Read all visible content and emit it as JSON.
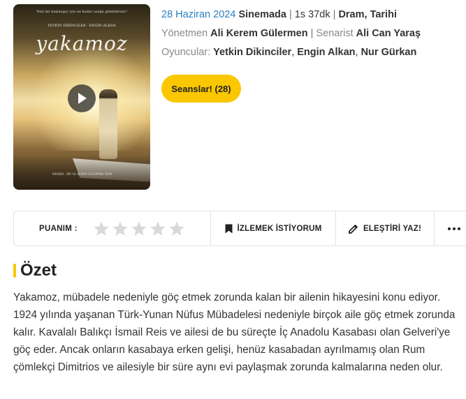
{
  "poster": {
    "title": "yakamoz",
    "tagline": "Yeni bir başlangıç için ne kadar uzağa gidebilirsin?",
    "actor_names": "YETKİN DİKİNCİLER · ENGİN ALKAN",
    "credits": "YAKINDA · BİR ALİ KEREM GÜLERMEN FİLMİ"
  },
  "info": {
    "date": "28 Haziran 2024",
    "status": "Sinemada",
    "duration": "1s 37dk",
    "genres": "Dram, Tarihi",
    "director_label": "Yönetmen",
    "director": "Ali Kerem Gülermen",
    "writer_label": "Senarist",
    "writer": "Ali Can Yaraş",
    "cast_label": "Oyuncular:",
    "cast": [
      "Yetkin Dikinciler",
      "Engin Alkan",
      "Nur Gürkan"
    ]
  },
  "showtimes_button": "Seanslar! (28)",
  "actions": {
    "rating_label": "PUANIM :",
    "stars_count": 5,
    "rating_value": 0,
    "watchlist_label": "İZLEMEK İSTİYORUM",
    "critic_label": "ELEŞTİRİ YAZ!"
  },
  "summary": {
    "heading": "Özet",
    "text": "Yakamoz, mübadele nedeniyle göç etmek zorunda kalan bir ailenin hikayesini konu ediyor. 1924 yılında yaşanan Türk-Yunan Nüfus Mübadelesi nedeniyle birçok aile göç etmek zorunda kalır. Kavalalı Balıkçı İsmail Reis ve ailesi de bu süreçte İç Anadolu Kasabası olan Gelveri'ye göç eder. Ancak onların kasabaya erken gelişi, henüz kasabadan ayrılmamış olan Rum çömlekçi Dimitrios ve ailesiyle bir süre aynı evi paylaşmak zorunda kalmalarına neden olur."
  },
  "colors": {
    "accent": "#fbc700",
    "link_blue": "#2a7fc1",
    "star_empty": "#d9d9d9"
  }
}
